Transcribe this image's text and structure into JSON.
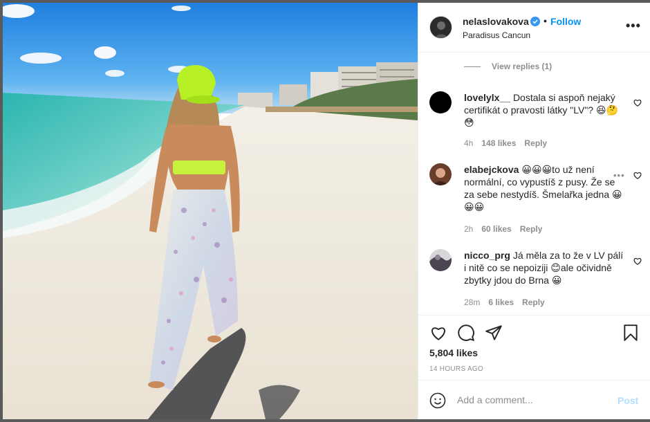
{
  "header": {
    "username": "nelaslovakova",
    "separator": "•",
    "follow_label": "Follow",
    "location": "Paradisus Cancun",
    "more_icon": "more-horizontal-icon",
    "more_label": "•••"
  },
  "thread": {
    "view_replies_label": "View replies (1)"
  },
  "comments": [
    {
      "username": "lovelylx__",
      "text": "Dostala si aspoň nejaký certifikát o pravosti látky \"LV\"? 😆🤔😳",
      "time": "4h",
      "likes": "148 likes",
      "reply_label": "Reply"
    },
    {
      "username": "elabejckova",
      "text": "😀😀😀to už není normální, co vypustíš z pusy. Že se za sebe nestydíš. Šmelařka jedna 😀😀😀",
      "time": "2h",
      "likes": "60 likes",
      "reply_label": "Reply",
      "more_label": "•••"
    },
    {
      "username": "nicco_prg",
      "text": "Já měla za to že v LV pálí i nitě co se nepoiziji 😊ale očividně zbytky jdou do Brna 😀",
      "time": "28m",
      "likes": "6 likes",
      "reply_label": "Reply"
    }
  ],
  "actions": {
    "likes_count": "5,804 likes",
    "time_ago": "14 HOURS AGO"
  },
  "composer": {
    "placeholder": "Add a comment...",
    "post_label": "Post"
  },
  "colors": {
    "accent": "#0095f6",
    "post_disabled": "#b2dffc",
    "muted": "#8e8e8e"
  }
}
